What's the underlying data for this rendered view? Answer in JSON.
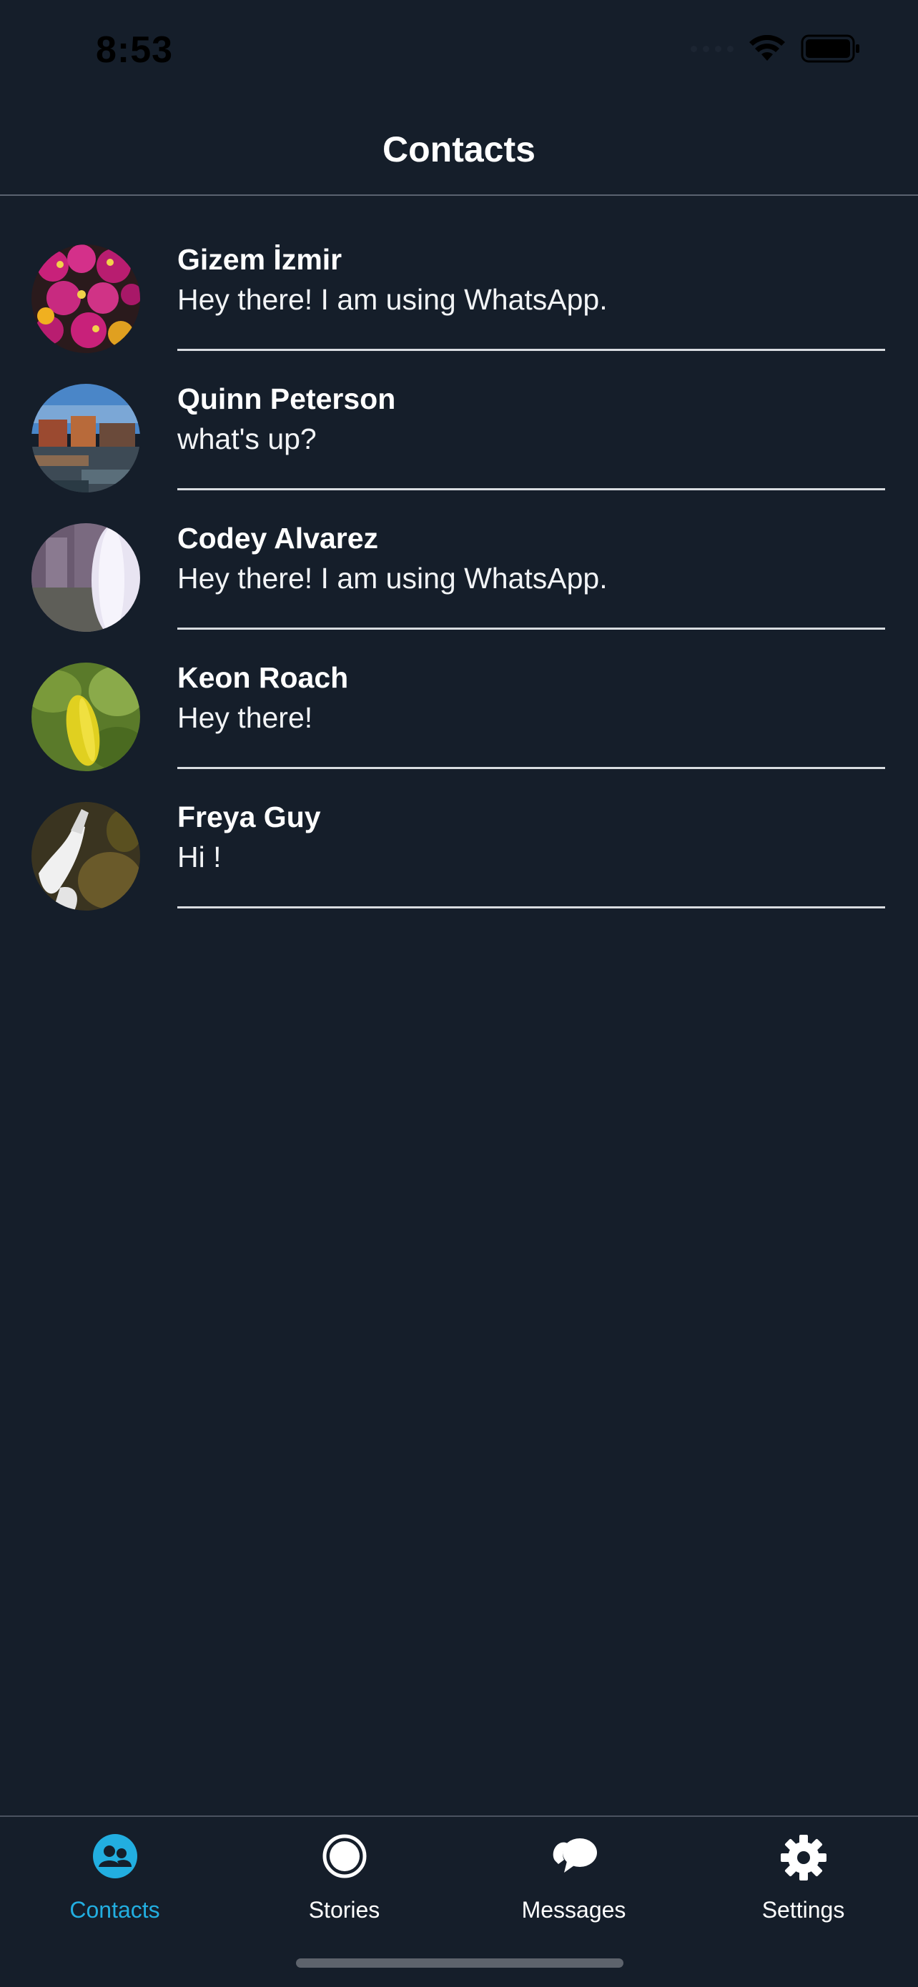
{
  "status_bar": {
    "time": "8:53"
  },
  "header": {
    "title": "Contacts"
  },
  "contacts": [
    {
      "name": "Gizem İzmir",
      "message": "Hey there! I am using WhatsApp."
    },
    {
      "name": "Quinn Peterson",
      "message": "what's up?"
    },
    {
      "name": "Codey Alvarez",
      "message": "Hey there! I am using WhatsApp."
    },
    {
      "name": "Keon Roach",
      "message": "Hey there!"
    },
    {
      "name": "Freya Guy",
      "message": "Hi !"
    }
  ],
  "tabs": [
    {
      "label": "Contacts",
      "icon": "contacts-icon",
      "active": true
    },
    {
      "label": "Stories",
      "icon": "stories-icon",
      "active": false
    },
    {
      "label": "Messages",
      "icon": "messages-icon",
      "active": false
    },
    {
      "label": "Settings",
      "icon": "settings-icon",
      "active": false
    }
  ],
  "colors": {
    "background": "#151e2a",
    "accent": "#22aee0",
    "text": "#ffffff"
  }
}
